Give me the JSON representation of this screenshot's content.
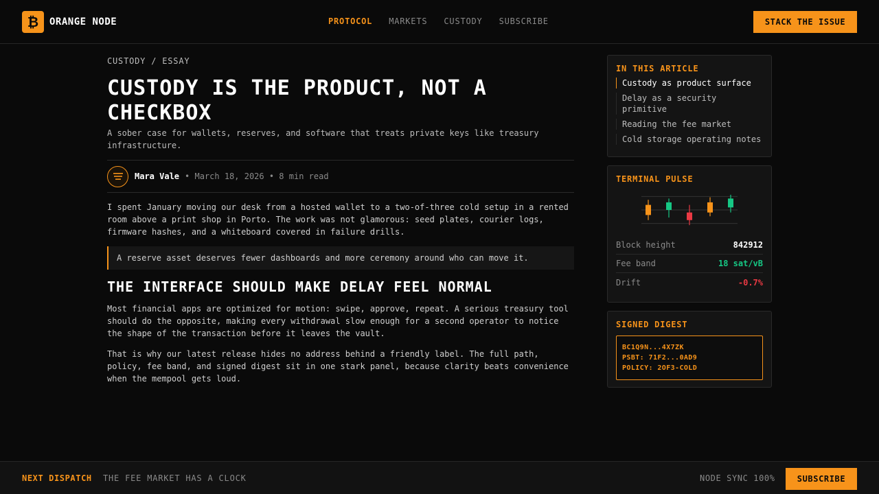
{
  "colors": {
    "accent": "#f7931a",
    "up": "#16c784",
    "down": "#ea3943",
    "background": "#0a0a0a"
  },
  "header": {
    "logo_icon": "bitcoin-icon",
    "logo_glyph": "₿",
    "brand": "ORANGE NODE",
    "nav": [
      {
        "label": "PROTOCOL",
        "active": true
      },
      {
        "label": "MARKETS",
        "active": false
      },
      {
        "label": "CUSTODY",
        "active": false
      },
      {
        "label": "SUBSCRIBE",
        "active": false
      }
    ],
    "cta": "STACK THE ISSUE"
  },
  "article": {
    "breadcrumb": "CUSTODY / ESSAY",
    "title": "CUSTODY IS THE PRODUCT, NOT A CHECKBOX",
    "subtitle": "A sober case for wallets, reserves, and software that treats private keys like treasury infrastructure.",
    "author": "Mara Vale",
    "meta": "• March 18, 2026 • 8 min read",
    "avatar_icon": "menu-lines-icon",
    "paragraph_1": "I spent January moving our desk from a hosted wallet to a two-of-three cold setup in a rented room above a print shop in Porto. The work was not glamorous: seed plates, courier logs, firmware hashes, and a whiteboard covered in failure drills.",
    "quote": "A reserve asset deserves fewer dashboards and more ceremony around who can move it.",
    "heading_2": "THE INTERFACE SHOULD MAKE DELAY FEEL NORMAL",
    "paragraph_2": "Most financial apps are optimized for motion: swipe, approve, repeat. A serious treasury tool should do the opposite, making every withdrawal slow enough for a second operator to notice the shape of the transaction before it leaves the vault.",
    "paragraph_3": "That is why our latest release hides no address behind a friendly label. The full path, policy, fee band, and signed digest sit in one stark panel, because clarity beats convenience when the mempool gets loud."
  },
  "sidebar": {
    "toc_title": "IN THIS ARTICLE",
    "toc": [
      {
        "label": "Custody as product surface",
        "active": true
      },
      {
        "label": "Delay as a security primitive",
        "active": false
      },
      {
        "label": "Reading the fee market",
        "active": false
      },
      {
        "label": "Cold storage operating notes",
        "active": false
      }
    ],
    "pulse_title": "TERMINAL PULSE",
    "stats": [
      {
        "label": "Block height",
        "value": "842912",
        "tone": "neutral"
      },
      {
        "label": "Fee band",
        "value": "18 sat/vB",
        "tone": "up"
      },
      {
        "label": "Drift",
        "value": "-0.7%",
        "tone": "down"
      }
    ],
    "digest_title": "SIGNED DIGEST",
    "digest_lines": [
      "BC1Q9N...4X7ZK",
      "PSBT: 71F2...0AD9",
      "POLICY: 2OF3-COLD"
    ]
  },
  "chart_data": {
    "type": "candlestick",
    "candles": [
      {
        "open": 44,
        "close": 52,
        "high": 56,
        "low": 40,
        "color": "accent"
      },
      {
        "open": 48,
        "close": 54,
        "high": 57,
        "low": 42,
        "color": "up"
      },
      {
        "open": 46,
        "close": 40,
        "high": 52,
        "low": 36,
        "color": "down"
      },
      {
        "open": 46,
        "close": 54,
        "high": 58,
        "low": 43,
        "color": "accent"
      },
      {
        "open": 50,
        "close": 57,
        "high": 60,
        "low": 46,
        "color": "up"
      }
    ],
    "ylim": [
      35,
      61
    ],
    "grid": true
  },
  "footer": {
    "label": "NEXT DISPATCH",
    "text": "THE FEE MARKET HAS A CLOCK",
    "sync": "NODE SYNC 100%",
    "button": "SUBSCRIBE"
  }
}
